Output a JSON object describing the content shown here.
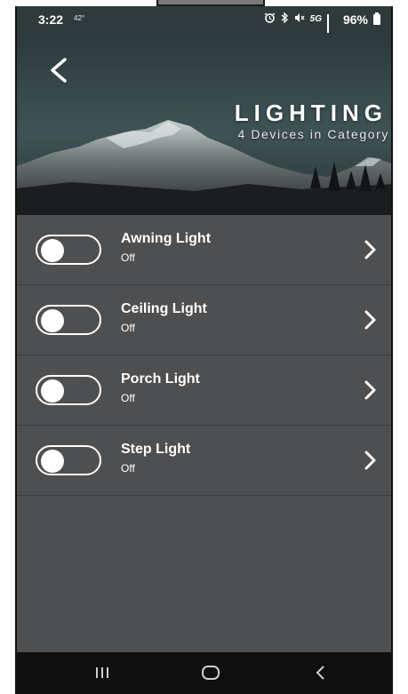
{
  "status_bar": {
    "time": "3:22",
    "temperature": "42°",
    "network": "5G",
    "battery": "96%",
    "icons": [
      "alarm-icon",
      "bluetooth-icon",
      "mute-icon",
      "signal-icon",
      "battery-icon"
    ]
  },
  "header": {
    "title": "LIGHTING",
    "subtitle": "4 Devices in Category",
    "back_icon": "back-chevron-icon"
  },
  "devices": [
    {
      "name": "Awning Light",
      "status": "Off",
      "on": false
    },
    {
      "name": "Ceiling Light",
      "status": "Off",
      "on": false
    },
    {
      "name": "Porch Light",
      "status": "Off",
      "on": false
    },
    {
      "name": "Step Light",
      "status": "Off",
      "on": false
    }
  ],
  "nav_bar": {
    "buttons": [
      "recent-apps-icon",
      "home-icon",
      "back-icon"
    ]
  },
  "colors": {
    "background": "#4e4f51",
    "divider": "#3e3f41",
    "text": "#ffffff",
    "nav_bar": "#0f0f0f"
  }
}
